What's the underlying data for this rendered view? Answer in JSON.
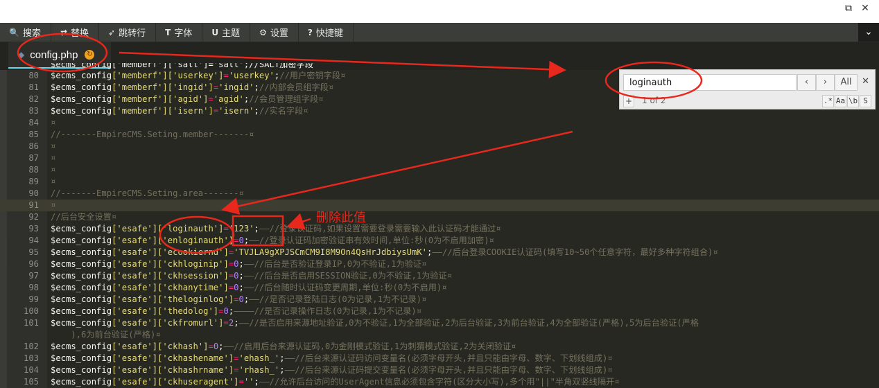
{
  "window": {
    "restore_glyph": "⧉",
    "close_glyph": "✕"
  },
  "toolbar": {
    "items": [
      {
        "icon": "search-icon",
        "glyph": "🔍",
        "label": "搜索"
      },
      {
        "icon": "replace-icon",
        "glyph": "⇄",
        "label": "替换"
      },
      {
        "icon": "goto-line-icon",
        "glyph": "➶",
        "label": "跳转行"
      },
      {
        "icon": "font-icon",
        "glyph": "T",
        "label": "字体"
      },
      {
        "icon": "theme-icon",
        "glyph": "U",
        "label": "主题"
      },
      {
        "icon": "gear-icon",
        "glyph": "⚙",
        "label": "设置"
      },
      {
        "icon": "help-icon",
        "glyph": "?",
        "label": "快捷键"
      }
    ],
    "collapse_glyph": "⌄"
  },
  "tab": {
    "file_name": "config.php"
  },
  "search": {
    "query": "loginauth",
    "prev": "‹",
    "next": "›",
    "all": "All",
    "close": "✕",
    "plus": "+",
    "counter": "1 of 2",
    "options": [
      ".*",
      "Aa",
      "\\b",
      "S"
    ]
  },
  "annotation": {
    "label": "删除此值"
  },
  "code": {
    "top_partial": "$ecms_config['memberf']['salt']='salt';//SALT加密字段",
    "lines": [
      {
        "n": "80",
        "var": "$ecms_config",
        "keys": "['memberf']['userkey']",
        "eq": "=",
        "val": "'userkey'",
        "end": ";",
        "comment": "//用户密钥字段¤"
      },
      {
        "n": "81",
        "var": "$ecms_config",
        "keys": "['memberf']['ingid']",
        "eq": "=",
        "val": "'ingid'",
        "end": ";",
        "comment": "//内部会员组字段¤"
      },
      {
        "n": "82",
        "var": "$ecms_config",
        "keys": "['memberf']['agid']",
        "eq": "=",
        "val": "'agid'",
        "end": ";",
        "comment": "//会员管理组字段¤"
      },
      {
        "n": "83",
        "var": "$ecms_config",
        "keys": "['memberf']['isern']",
        "eq": "=",
        "val": "'isern'",
        "end": ";",
        "comment": "//实名字段¤"
      },
      {
        "n": "84",
        "comment": "¤"
      },
      {
        "n": "85",
        "comment": "//-------EmpireCMS.Seting.member-------¤"
      },
      {
        "n": "86",
        "comment": "¤"
      },
      {
        "n": "87",
        "comment": "¤"
      },
      {
        "n": "88",
        "comment": "¤"
      },
      {
        "n": "89",
        "comment": "¤"
      },
      {
        "n": "90",
        "comment": "//-------EmpireCMS.Seting.area-------¤"
      },
      {
        "n": "91",
        "comment": "¤"
      },
      {
        "n": "92",
        "comment": "//后台安全设置¤"
      },
      {
        "n": "93",
        "var": "$ecms_config",
        "keys": "['esafe']['loginauth']",
        "eq": "=",
        "val": "'123'",
        "end": ";",
        "comment": "——//登录认证码,如果设置需要登录需要输入此认证码才能通过¤"
      },
      {
        "n": "94",
        "var": "$ecms_config",
        "keys": "['esafe']['enloginauth']",
        "eq": "=",
        "num": "0",
        "end": ";",
        "comment": "——//登录认证码加密验证串有效时间,单位:秒(0为不启用加密)¤"
      },
      {
        "n": "95",
        "var": "$ecms_config",
        "keys": "['esafe']['ecookiernd']",
        "eq": "=",
        "val": "'TVJLA9gXPJSCmCM9I8M9On4QsHrJdbiysUmK'",
        "end": ";",
        "comment": "——//后台登录COOKIE认证码(填写10~50个任意字符，最好多种字符组合)¤"
      },
      {
        "n": "96",
        "var": "$ecms_config",
        "keys": "['esafe']['ckhloginip']",
        "eq": "=",
        "num": "0",
        "end": ";",
        "comment": "——//后台是否验证登录IP,0为不验证,1为验证¤"
      },
      {
        "n": "97",
        "var": "$ecms_config",
        "keys": "['esafe']['ckhsession']",
        "eq": "=",
        "num": "0",
        "end": ";",
        "comment": "——//后台是否启用SESSION验证,0为不验证,1为验证¤"
      },
      {
        "n": "98",
        "var": "$ecms_config",
        "keys": "['esafe']['ckhanytime']",
        "eq": "=",
        "num": "0",
        "end": ";",
        "comment": "——//后台随时认证码变更周期,单位:秒(0为不启用)¤"
      },
      {
        "n": "99",
        "var": "$ecms_config",
        "keys": "['esafe']['theloginlog']",
        "eq": "=",
        "num": "0",
        "end": ";",
        "comment": "——//是否记录登陆日志(0为记录,1为不记录)¤"
      },
      {
        "n": "100",
        "var": "$ecms_config",
        "keys": "['esafe']['thedolog']",
        "eq": "=",
        "num": "0",
        "end": ";",
        "comment": "————//是否记录操作日志(0为记录,1为不记录)¤"
      },
      {
        "n": "101",
        "var": "$ecms_config",
        "keys": "['esafe']['ckfromurl']",
        "eq": "=",
        "num": "2",
        "end": ";",
        "comment": "——//是否启用来源地址验证,0为不验证,1为全部验证,2为后台验证,3为前台验证,4为全部验证(严格),5为后台验证(严格"
      },
      {
        "n": "",
        "comment": "    ),6为前台验证(严格)¤"
      },
      {
        "n": "102",
        "var": "$ecms_config",
        "keys": "['esafe']['ckhash']",
        "eq": "=",
        "num": "0",
        "end": ";",
        "comment": "——//启用后台来源认证码,0为金刚模式验证,1为刺猬模式验证,2为关闭验证¤"
      },
      {
        "n": "103",
        "var": "$ecms_config",
        "keys": "['esafe']['ckhashename']",
        "eq": "=",
        "val": "'ehash_'",
        "end": ";",
        "comment": "——//后台来源认证码访问变量名(必须字母开头,并且只能由字母、数字、下划线组成)¤"
      },
      {
        "n": "104",
        "var": "$ecms_config",
        "keys": "['esafe']['ckhashrname']",
        "eq": "=",
        "val": "'rhash_'",
        "end": ";",
        "comment": "——//后台来源认证码提交变量名(必须字母开头,并且只能由字母、数字、下划线组成)¤"
      },
      {
        "n": "105",
        "var": "$ecms_config",
        "keys": "['esafe']['ckhuseragent']",
        "eq": "=",
        "val": "''",
        "end": ";",
        "comment": "——//允许后台访问的UserAgent信息必须包含字符(区分大小写),多个用\"||\"半角双竖线隔开¤"
      }
    ]
  }
}
